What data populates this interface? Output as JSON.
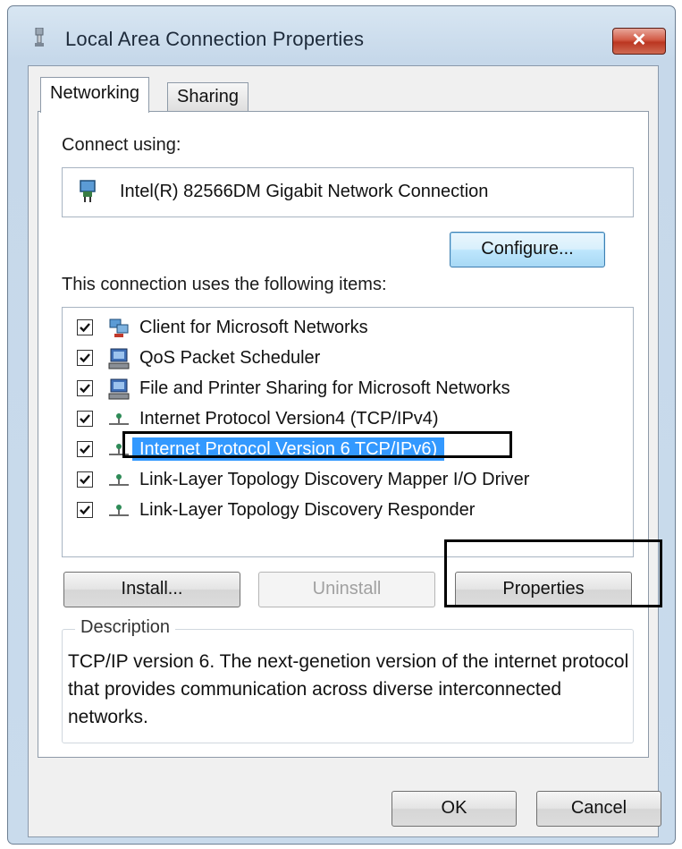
{
  "window": {
    "title": "Local Area Connection Properties",
    "close_glyph": "✕"
  },
  "tabs": [
    {
      "label": "Networking",
      "active": true
    },
    {
      "label": "Sharing",
      "active": false
    }
  ],
  "connect_using": {
    "label": "Connect using:",
    "adapter": "Intel(R) 82566DM Gigabit Network Connection",
    "configure_label": "Configure..."
  },
  "items_section": {
    "label": "This connection uses the following items:",
    "items": [
      {
        "label": "Client for Microsoft Networks",
        "checked": true,
        "icon": "network-client-icon"
      },
      {
        "label": "QoS Packet Scheduler",
        "checked": true,
        "icon": "network-service-icon"
      },
      {
        "label": "File and Printer Sharing for Microsoft Networks",
        "checked": true,
        "icon": "network-service-icon"
      },
      {
        "label": "Internet Protocol Version4  (TCP/IPv4)",
        "checked": true,
        "icon": "protocol-icon"
      },
      {
        "label": "Internet Protocol Version 6  TCP/IPv6)",
        "checked": true,
        "icon": "protocol-icon",
        "selected": true
      },
      {
        "label": "Link-Layer Topology Discovery Mapper I/O Driver",
        "checked": true,
        "icon": "protocol-icon"
      },
      {
        "label": "Link-Layer Topology Discovery Responder",
        "checked": true,
        "icon": "protocol-icon"
      }
    ]
  },
  "buttons": {
    "install": "Install...",
    "uninstall": "Uninstall",
    "properties": "Properties"
  },
  "description": {
    "title": "Description",
    "text": "TCP/IP version 6. The next-genetion version of the internet protocol that provides communication across diverse interconnected networks."
  },
  "footer": {
    "ok": "OK",
    "cancel": "Cancel"
  },
  "colors": {
    "selection": "#3399ff",
    "annotation": "#000000"
  }
}
